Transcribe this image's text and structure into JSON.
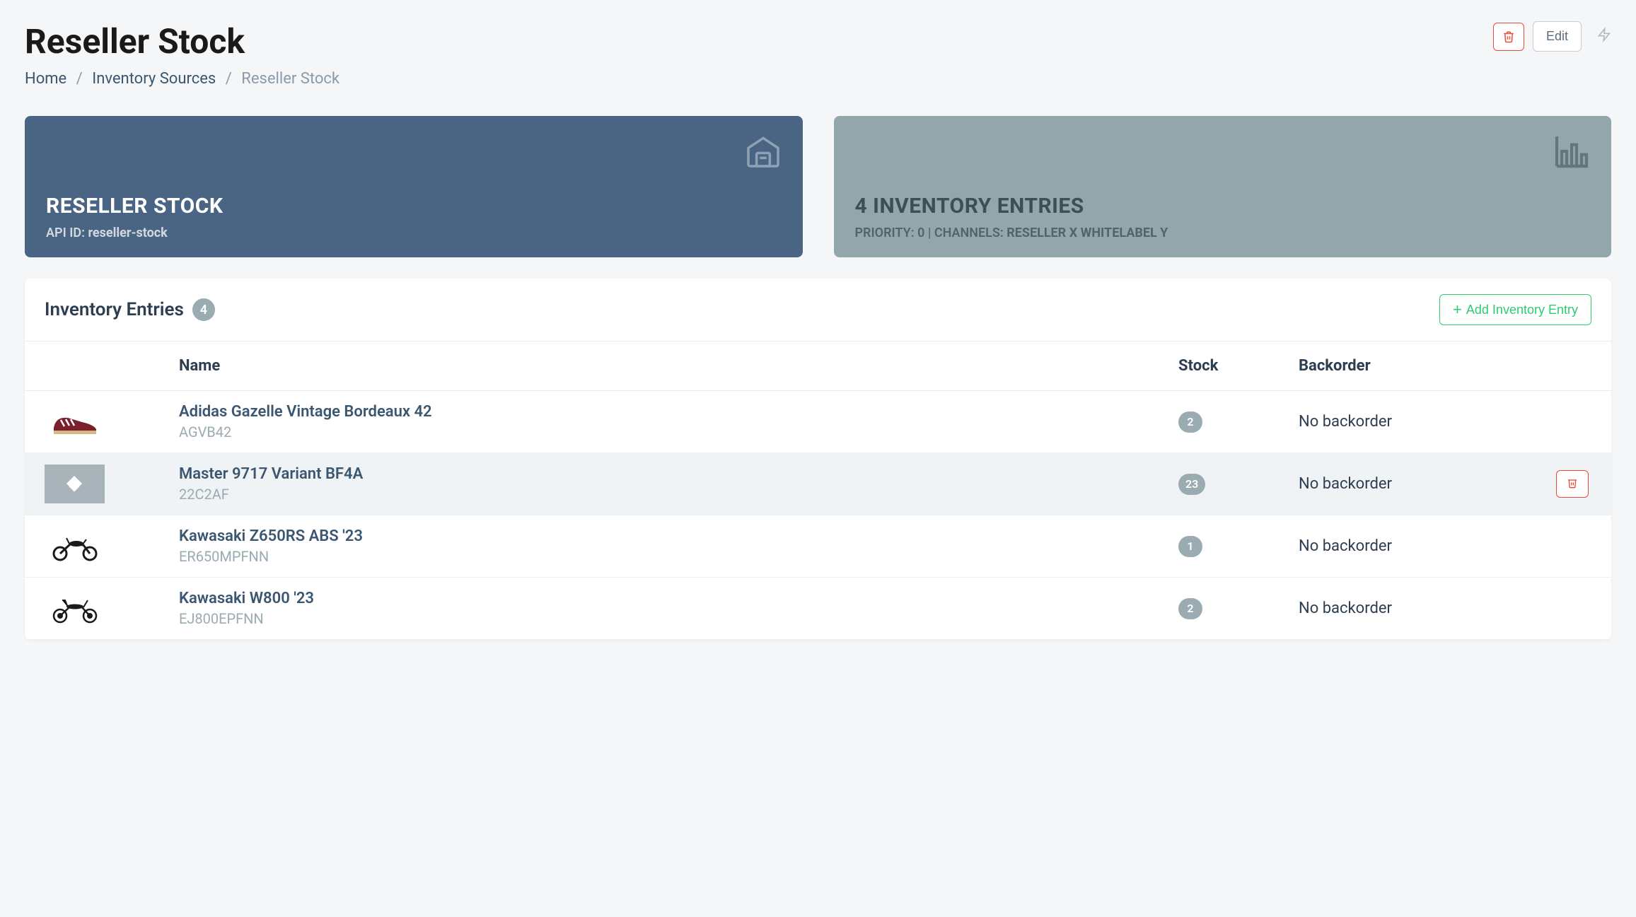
{
  "header": {
    "title": "Reseller Stock",
    "breadcrumb": {
      "home": "Home",
      "inventory_sources": "Inventory Sources",
      "current": "Reseller Stock"
    },
    "edit_label": "Edit"
  },
  "cards": {
    "left": {
      "title": "RESELLER STOCK",
      "sub_prefix": "API ID: ",
      "sub_value": "reseller-stock"
    },
    "right": {
      "title": "4 INVENTORY ENTRIES",
      "sub_prefix": "PRIORITY: 0 | CHANNELS: ",
      "sub_value": "RESELLER X WHITELABEL Y"
    }
  },
  "panel": {
    "title": "Inventory Entries",
    "count": "4",
    "add_label": "Add Inventory Entry",
    "columns": {
      "name": "Name",
      "stock": "Stock",
      "backorder": "Backorder"
    },
    "rows": [
      {
        "name": "Adidas Gazelle Vintage Bordeaux 42",
        "sku": "AGVB42",
        "stock": "2",
        "backorder": "No backorder",
        "thumb": "sneaker",
        "hover": false
      },
      {
        "name": "Master 9717 Variant BF4A",
        "sku": "22C2AF",
        "stock": "23",
        "backorder": "No backorder",
        "thumb": "placeholder",
        "hover": true
      },
      {
        "name": "Kawasaki Z650RS ABS '23",
        "sku": "ER650MPFNN",
        "stock": "1",
        "backorder": "No backorder",
        "thumb": "moto1",
        "hover": false
      },
      {
        "name": "Kawasaki W800 '23",
        "sku": "EJ800EPFNN",
        "stock": "2",
        "backorder": "No backorder",
        "thumb": "moto2",
        "hover": false
      }
    ]
  }
}
